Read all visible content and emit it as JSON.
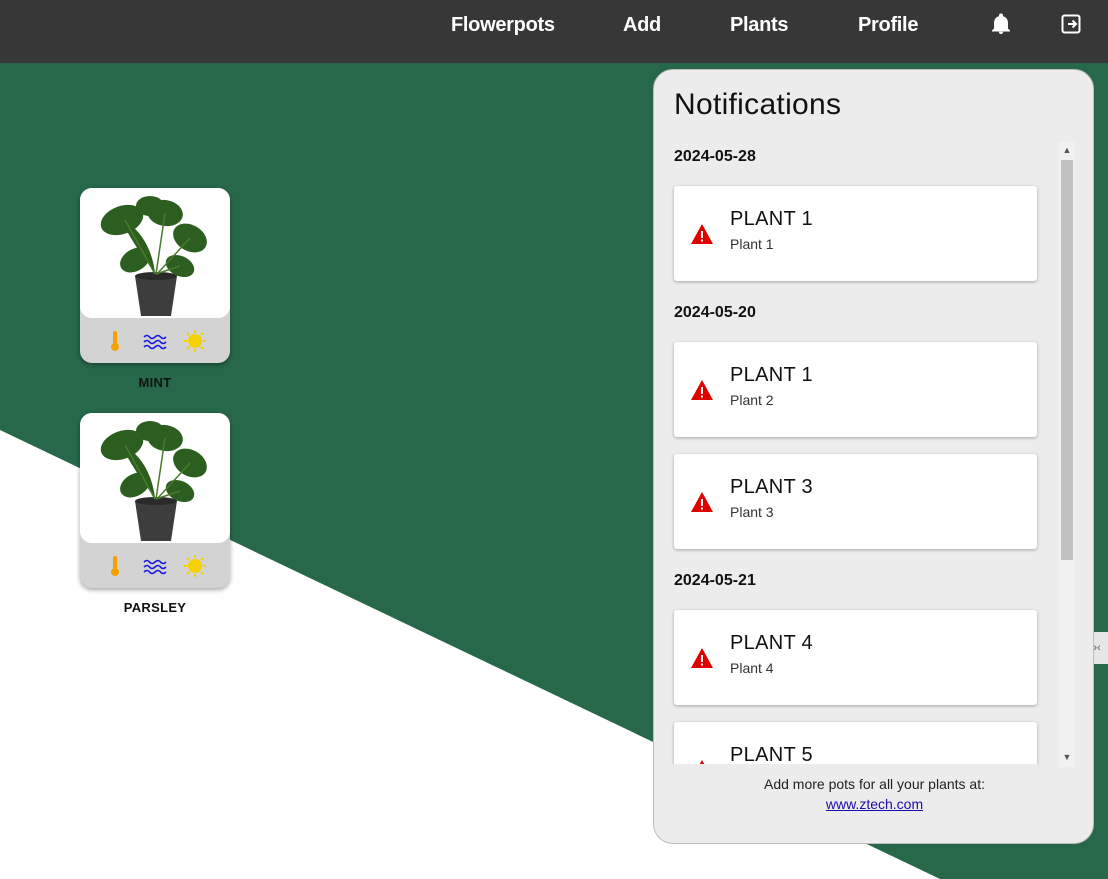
{
  "nav": {
    "items": [
      {
        "label": "Flowerpots"
      },
      {
        "label": "Add"
      },
      {
        "label": "Plants"
      },
      {
        "label": "Profile"
      }
    ],
    "icons": [
      "bell-icon",
      "logout-icon"
    ]
  },
  "pots": [
    {
      "name": "MINT",
      "icons": [
        "thermometer-icon",
        "water-icon",
        "sun-icon"
      ]
    },
    {
      "name": "PARSLEY",
      "icons": [
        "thermometer-icon",
        "water-icon",
        "sun-icon"
      ]
    }
  ],
  "notifications": {
    "title": "Notifications",
    "groups": [
      {
        "date": "2024-05-28",
        "items": [
          {
            "title": "PLANT 1",
            "subtitle": "Plant 1"
          }
        ]
      },
      {
        "date": "2024-05-20",
        "items": [
          {
            "title": "PLANT 1",
            "subtitle": "Plant 2"
          },
          {
            "title": "PLANT 3",
            "subtitle": "Plant 3"
          }
        ]
      },
      {
        "date": "2024-05-21",
        "items": [
          {
            "title": "PLANT 4",
            "subtitle": "Plant 4"
          },
          {
            "title": "PLANT 5",
            "subtitle": ""
          }
        ]
      }
    ],
    "footer_text": "Add more pots for all your plants at:",
    "footer_link": "www.ztech.com"
  },
  "colors": {
    "topbar": "#373737",
    "green": "#27684a",
    "warning": "#e00000",
    "thermo": "#f5a000",
    "water": "#1a1ae6",
    "sun": "#f5d000"
  }
}
